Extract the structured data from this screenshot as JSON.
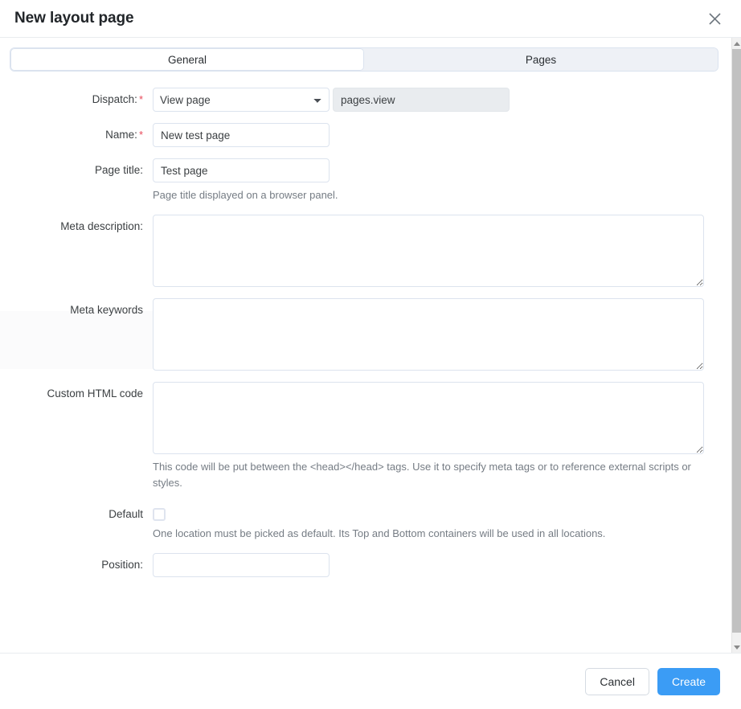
{
  "dialog": {
    "title": "New layout page",
    "close_icon": "close-icon"
  },
  "tabs": [
    {
      "label": "General",
      "active": true
    },
    {
      "label": "Pages",
      "active": false
    }
  ],
  "form": {
    "dispatch": {
      "label": "Dispatch:",
      "required_marker": "*",
      "selected": "View page",
      "options": [
        "View page"
      ],
      "readonly_value": "pages.view"
    },
    "name": {
      "label": "Name:",
      "required_marker": "*",
      "value": "New test page"
    },
    "page_title": {
      "label": "Page title:",
      "value": "Test page",
      "help": "Page title displayed on a browser panel."
    },
    "meta_description": {
      "label": "Meta description:",
      "value": ""
    },
    "meta_keywords": {
      "label": "Meta keywords",
      "value": ""
    },
    "custom_html": {
      "label": "Custom HTML code",
      "value": "",
      "help": "This code will be put between the <head></head> tags. Use it to specify meta tags or to reference external scripts or styles."
    },
    "default": {
      "label": "Default",
      "checked": false,
      "help": "One location must be picked as default. Its Top and Bottom containers will be used in all locations."
    },
    "position": {
      "label": "Position:",
      "value": ""
    }
  },
  "footer": {
    "cancel_label": "Cancel",
    "create_label": "Create",
    "create_color": "#3b9cf5"
  },
  "scrollbar": {
    "up_icon": "chevron-up-icon",
    "down_icon": "chevron-down-icon"
  }
}
